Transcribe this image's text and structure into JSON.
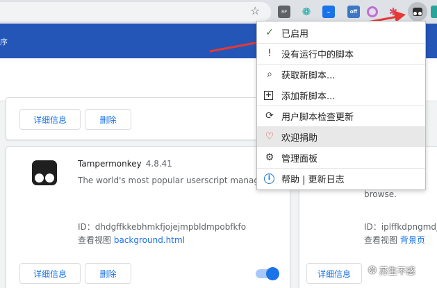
{
  "toolbar": {
    "bookmark_icon": "star-icon",
    "extensions": [
      {
        "name": "rp-extension-icon",
        "text": "RP"
      },
      {
        "name": "gear-extension-icon"
      },
      {
        "name": "download-extension-icon"
      },
      {
        "name": "off-extension-icon",
        "text": "off"
      },
      {
        "name": "ring-extension-icon"
      },
      {
        "name": "star-extension-icon"
      },
      {
        "name": "tampermonkey-extension-icon"
      },
      {
        "name": "teal-extension-icon"
      }
    ]
  },
  "header": {
    "partial_title": "序"
  },
  "cards": {
    "top_left": {
      "details_label": "详细信息",
      "remove_label": "删除"
    },
    "tampermonkey": {
      "name": "Tampermonkey",
      "version": "4.8.41",
      "description": "The world's most popular userscript manager",
      "id_line": "ID：dhdgffkkebhmkfjojejmpbldmpobfkfo",
      "view_prefix": "查看视图",
      "view_link": "background.html",
      "details_label": "详细信息",
      "remove_label": "删除",
      "enabled": true
    },
    "right": {
      "description": "browse.",
      "id_line": "ID：iplffkdpngmdjh",
      "view_prefix": "查看视图",
      "view_link": "背景页",
      "details_label": "详细信息"
    }
  },
  "menu": {
    "items": [
      {
        "icon": "check-icon",
        "label": "已启用"
      },
      {
        "icon": "exclamation-icon",
        "label": "没有运行中的脚本"
      },
      {
        "icon": "search-icon",
        "label": "获取新脚本..."
      },
      {
        "icon": "plus-box-icon",
        "label": "添加新脚本..."
      },
      {
        "icon": "refresh-icon",
        "label": "用户脚本检查更新"
      },
      {
        "icon": "heart-icon",
        "label": "欢迎捐助"
      },
      {
        "icon": "gear-icon",
        "label": "管理面板"
      },
      {
        "icon": "info-icon",
        "label": "帮助 | 更新日志"
      }
    ]
  },
  "watermark": {
    "text": "苏生不惑"
  },
  "colors": {
    "accent": "#1a73e8",
    "header": "#2456b8",
    "arrow": "#e53935"
  }
}
